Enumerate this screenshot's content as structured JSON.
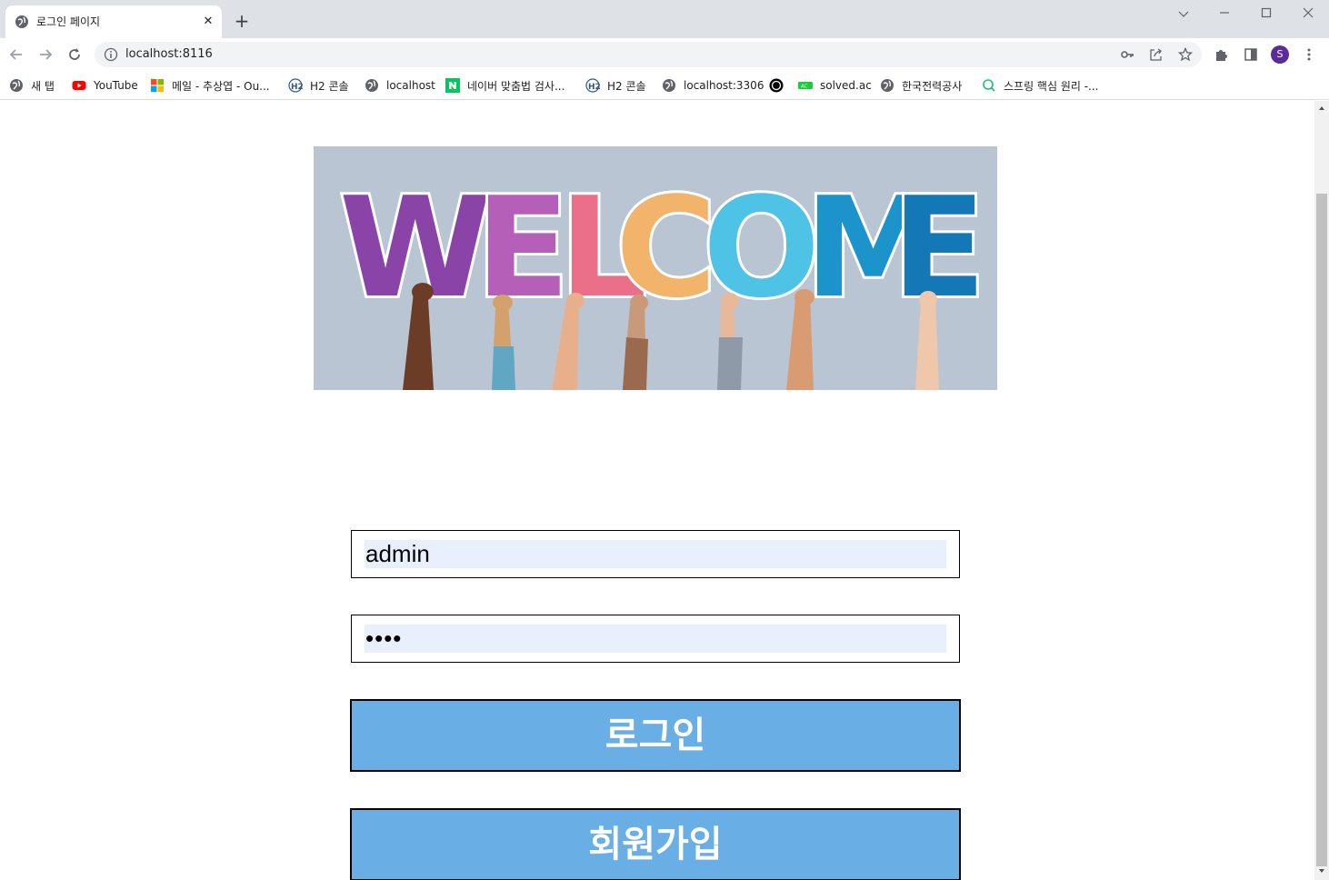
{
  "browser": {
    "tab_title": "로그인 페이지",
    "tab_close": "✕",
    "new_tab": "+",
    "url": "localhost:8116",
    "profile_initial": "S"
  },
  "bookmarks": [
    {
      "label": "새 탭",
      "icon": "globe-icon"
    },
    {
      "label": "YouTube",
      "icon": "youtube-icon"
    },
    {
      "label": "메일 - 추상엽 - Ou...",
      "icon": "microsoft-icon"
    },
    {
      "label": "H2 콘솔",
      "icon": "h2-icon"
    },
    {
      "label": "localhost",
      "icon": "globe-icon"
    },
    {
      "label": "네이버 맞춤법 검사...",
      "icon": "naver-icon"
    },
    {
      "label": "H2 콘솔",
      "icon": "h2-icon"
    },
    {
      "label": "localhost:3306",
      "icon": "globe-icon"
    },
    {
      "label": "",
      "icon": "circle-icon"
    },
    {
      "label": "solved.ac",
      "icon": "solvedac-icon"
    },
    {
      "label": "한국전력공사",
      "icon": "globe-icon"
    },
    {
      "label": "스프링 핵심 원리 -...",
      "icon": "inflearn-icon"
    }
  ],
  "banner": {
    "text": "WELCOME",
    "letter_colors": [
      "#8a44a8",
      "#b65fb8",
      "#ec6f89",
      "#f2b46a",
      "#4ec3e6",
      "#1c94cb",
      "#1578b6"
    ],
    "background": "#b9c5d3"
  },
  "form": {
    "username_value": "admin",
    "password_value": "••••",
    "login_label": "로그인",
    "signup_label": "회원가입"
  },
  "colors": {
    "button_bg": "#6aaee6",
    "autofill_bg": "#e8f0fe"
  }
}
